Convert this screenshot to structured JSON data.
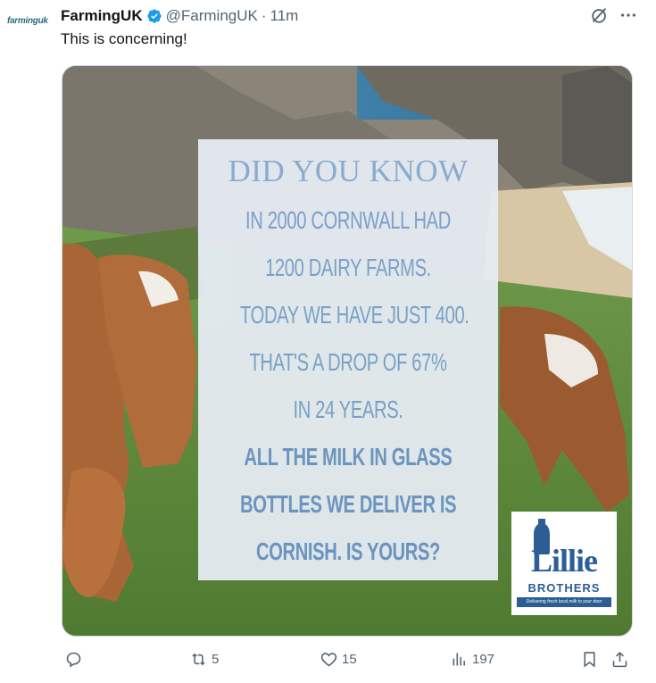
{
  "tweet": {
    "avatar_text": "farminguk",
    "author_name": "FarmingUK",
    "handle": "@FarmingUK",
    "separator": "·",
    "time": "11m",
    "text": "This is concerning!"
  },
  "image": {
    "title": "DID YOU KNOW",
    "lines": [
      "IN 2000 CORNWALL HAD",
      "1200 DAIRY FARMS.",
      "TODAY WE HAVE JUST 400.",
      "THAT'S A DROP OF 67%",
      "IN 24 YEARS."
    ],
    "bold_lines": [
      "ALL THE MILK IN GLASS",
      "BOTTLES WE DELIVER IS",
      "CORNISH. IS YOURS?"
    ],
    "logo": {
      "name": "Lillie",
      "subname": "BROTHERS",
      "tagline": "Delivering fresh local milk to your door"
    }
  },
  "actions": {
    "reply_count": "",
    "repost_count": "5",
    "like_count": "15",
    "view_count": "197"
  },
  "colors": {
    "verified": "#1d9bf0",
    "muted": "#536471",
    "card_text": "#7ba2cf",
    "logo_blue": "#2c5e95"
  },
  "icons": [
    "verified-badge-icon",
    "grok-icon",
    "more-icon",
    "reply-icon",
    "repost-icon",
    "like-icon",
    "views-icon",
    "bookmark-icon",
    "share-icon"
  ]
}
